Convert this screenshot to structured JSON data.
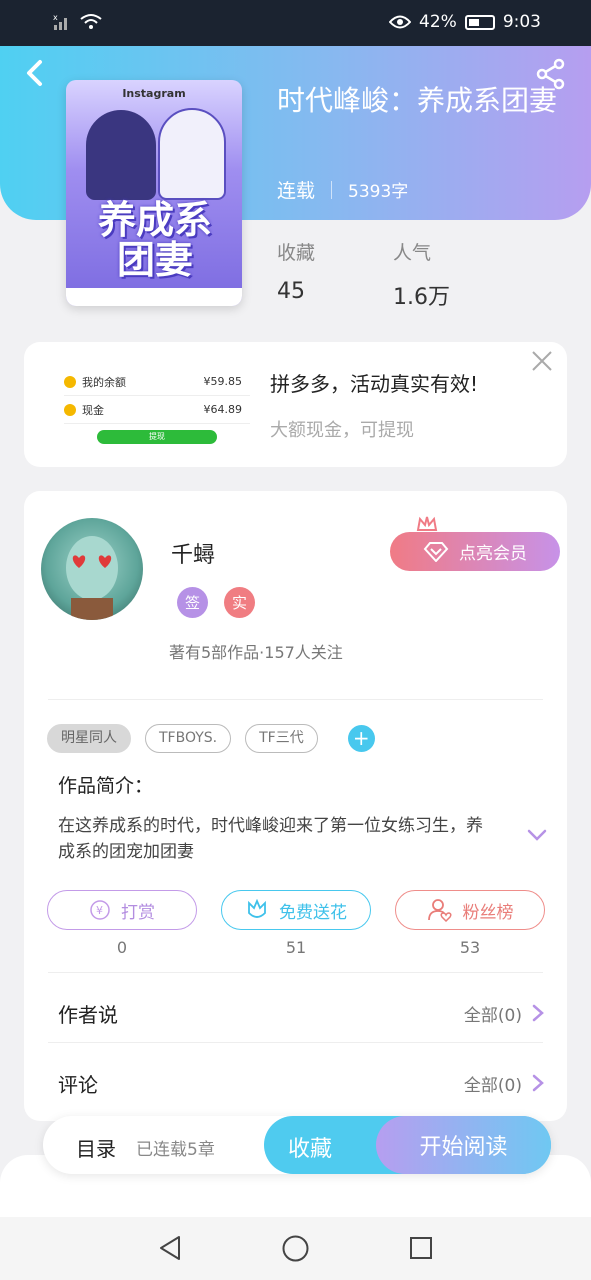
{
  "status_bar": {
    "battery_percent": "42%",
    "time": "9:03",
    "icons": [
      "signal-icon",
      "wifi-icon",
      "eye-icon",
      "battery-icon"
    ]
  },
  "header": {
    "back_icon": "chevron-left-icon",
    "share_icon": "share-icon"
  },
  "book": {
    "title": "时代峰峻：养成系团妻",
    "status": "连载",
    "word_count": "5393字",
    "stats": [
      {
        "label": "收藏",
        "value": "45"
      },
      {
        "label": "人气",
        "value": "1.6万"
      }
    ],
    "cover": {
      "top_text": "Instagram",
      "title_text": "养成系团妻"
    }
  },
  "ad": {
    "title": "拼多多，活动真实有效!",
    "subtitle": "大额现金，可提现",
    "thumb": {
      "row1_label": "我的余额",
      "row1_value": "¥59.85",
      "row2_label": "现金",
      "row2_value": "¥64.89",
      "button": "提现"
    },
    "close_icon": "close-icon"
  },
  "author": {
    "name": "千蟳",
    "badges": [
      "签",
      "实"
    ],
    "stats": "著有5部作品·157人关注",
    "vip_button": "点亮会员"
  },
  "tags": [
    "明星同人",
    "TFBOYS.",
    "TF三代"
  ],
  "intro": {
    "title": "作品简介：",
    "text": "在这养成系的时代，时代峰峻迎来了第一位女练习生，养成系的团宠加团妻"
  },
  "actions": [
    {
      "label": "打赏",
      "count": "0",
      "icon": "yen-icon"
    },
    {
      "label": "免费送花",
      "count": "51",
      "icon": "flower-icon"
    },
    {
      "label": "粉丝榜",
      "count": "53",
      "icon": "fans-icon"
    }
  ],
  "rows": [
    {
      "title": "作者说",
      "right": "全部(0)"
    },
    {
      "title": "评论",
      "right": "全部(0)"
    }
  ],
  "bottom_bar": {
    "toc_label": "目录",
    "toc_sub": "已连载5章",
    "favorite": "收藏",
    "start_reading": "开始阅读"
  },
  "colors": {
    "accent_blue": "#4fcbef",
    "accent_purple": "#b69ef0",
    "accent_pink": "#f07b85"
  }
}
